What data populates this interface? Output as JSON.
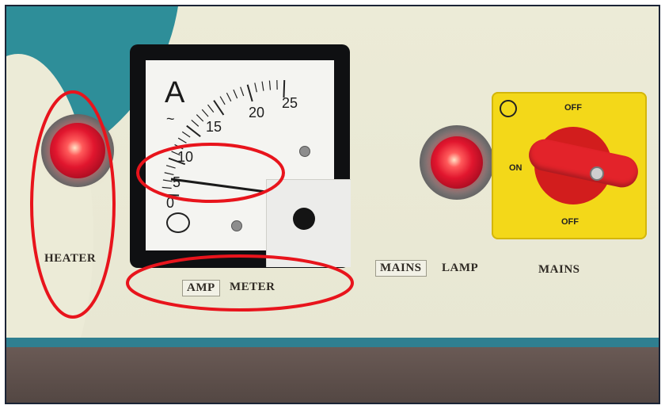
{
  "panel": {
    "heater_label": "HEATER",
    "meter_label_part1": "AMP",
    "meter_label_part2": "METER",
    "mains_lamp_part1": "MAINS",
    "mains_lamp_part2": "LAMP",
    "mains_label": "MAINS"
  },
  "ammeter": {
    "unit": "A",
    "ac_symbol": "~",
    "scale_labels": [
      "0",
      "5",
      "10",
      "15",
      "20",
      "25"
    ],
    "needle_reading": 5
  },
  "switch": {
    "off_top": "OFF",
    "on": "ON",
    "off_bottom": "OFF"
  },
  "colors": {
    "annotation": "#e8141c",
    "lamp_red": "#e1162e",
    "switch_yellow": "#f3d819",
    "handle_red": "#e3232a",
    "panel_teal": "#2e8e99"
  }
}
